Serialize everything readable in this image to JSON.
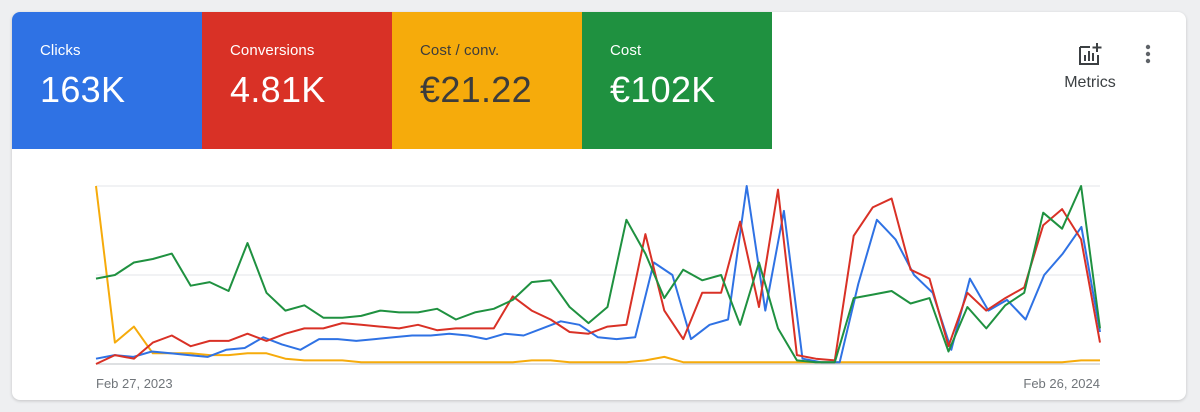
{
  "scorecards": [
    {
      "label": "Clicks",
      "value": "163K",
      "color": "#2f72e4"
    },
    {
      "label": "Conversions",
      "value": "4.81K",
      "color": "#d93126"
    },
    {
      "label": "Cost / conv.",
      "value": "€21.22",
      "color": "#f6ab0b"
    },
    {
      "label": "Cost",
      "value": "€102K",
      "color": "#1f9140"
    }
  ],
  "toolbar": {
    "metrics_label": "Metrics",
    "metrics_icon": "add-chart-icon",
    "more_icon": "more-vert-icon"
  },
  "chart_data": {
    "type": "line",
    "x_start_label": "Feb 27, 2023",
    "x_end_label": "Feb 26, 2024",
    "ylim": [
      0,
      100
    ],
    "grid": true,
    "normalized": true,
    "series": [
      {
        "name": "Clicks",
        "color": "#2f72e4",
        "values": [
          3,
          5,
          4,
          7,
          6,
          5,
          4,
          8,
          9,
          15,
          11,
          8,
          14,
          14,
          13,
          14,
          15,
          16,
          16,
          17,
          16,
          14,
          17,
          16,
          20,
          24,
          22,
          15,
          14,
          15,
          57,
          50,
          14,
          22,
          25,
          100,
          30,
          86,
          3,
          1,
          1,
          45,
          81,
          70,
          50,
          40,
          8,
          48,
          30,
          36,
          25,
          50,
          62,
          77,
          18
        ]
      },
      {
        "name": "Conversions",
        "color": "#d93126",
        "values": [
          0,
          5,
          3,
          12,
          16,
          10,
          13,
          13,
          17,
          13,
          17,
          20,
          20,
          23,
          22,
          21,
          20,
          22,
          19,
          20,
          20,
          20,
          38,
          30,
          25,
          18,
          17,
          21,
          22,
          73,
          30,
          14,
          40,
          40,
          80,
          32,
          98,
          5,
          3,
          2,
          72,
          88,
          93,
          53,
          48,
          10,
          40,
          30,
          37,
          43,
          78,
          87,
          70,
          12
        ]
      },
      {
        "name": "Cost / conv.",
        "color": "#f6ab0b",
        "values": [
          100,
          12,
          21,
          6,
          6,
          6,
          5,
          5,
          6,
          6,
          3,
          2,
          2,
          2,
          1,
          1,
          1,
          1,
          1,
          1,
          1,
          1,
          1,
          2,
          2,
          1,
          1,
          1,
          1,
          2,
          4,
          1,
          1,
          1,
          1,
          1,
          1,
          1,
          1,
          1,
          1,
          1,
          1,
          1,
          1,
          1,
          1,
          1,
          1,
          1,
          1,
          1,
          2,
          2
        ]
      },
      {
        "name": "Cost",
        "color": "#1f9140",
        "values": [
          48,
          50,
          57,
          59,
          62,
          44,
          46,
          41,
          68,
          40,
          30,
          33,
          26,
          26,
          27,
          30,
          29,
          29,
          31,
          25,
          29,
          31,
          36,
          46,
          47,
          32,
          23,
          32,
          81,
          62,
          37,
          53,
          47,
          50,
          22,
          57,
          20,
          2,
          1,
          1,
          37,
          39,
          41,
          34,
          37,
          7,
          32,
          20,
          33,
          40,
          85,
          76,
          100,
          20
        ]
      }
    ]
  }
}
